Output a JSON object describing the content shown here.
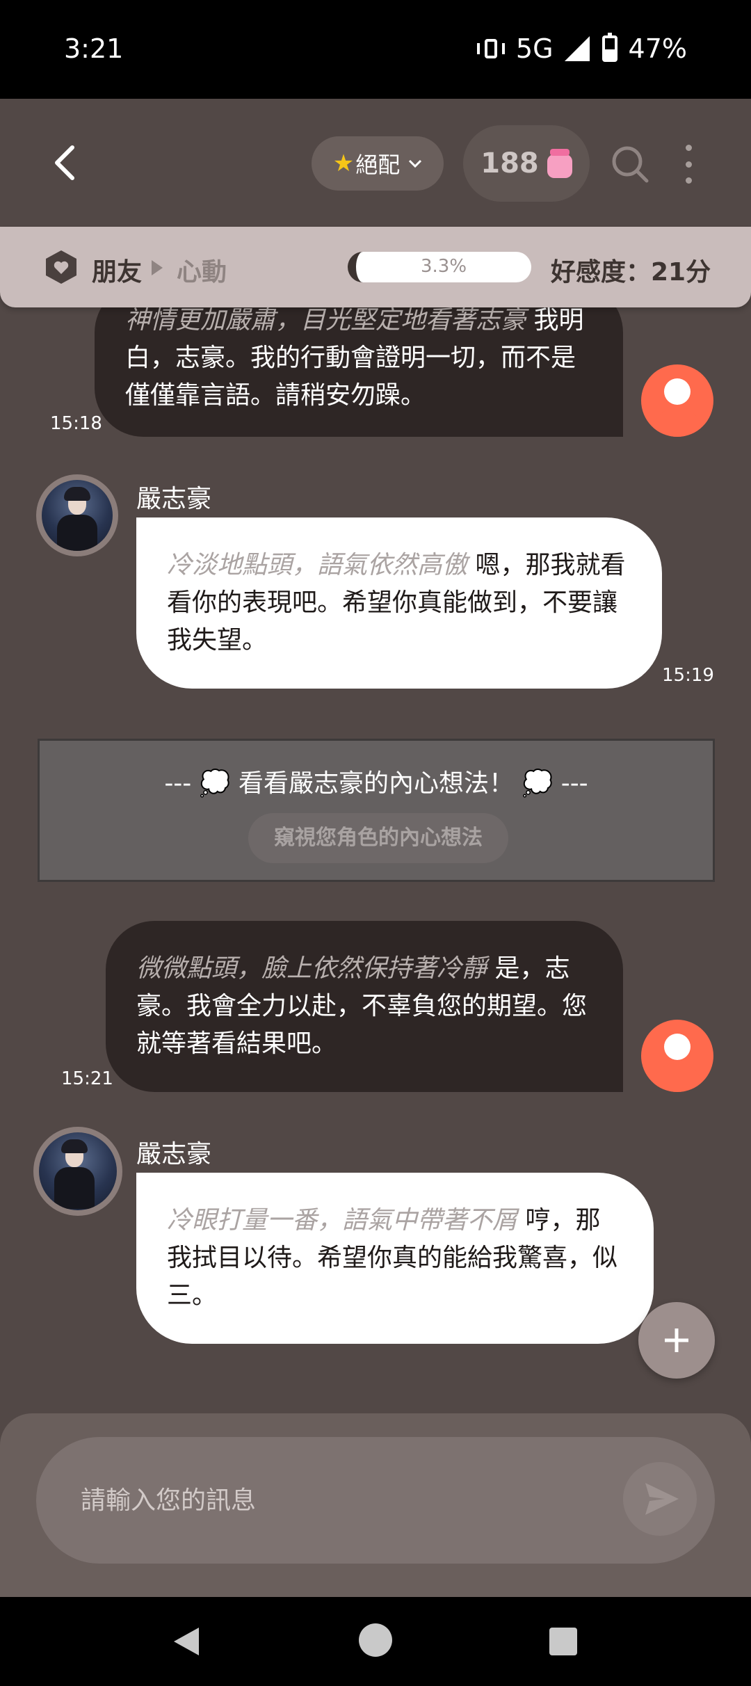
{
  "status": {
    "time": "3:21",
    "network": "5G",
    "battery": "47%"
  },
  "header": {
    "chip_label": "絕配",
    "coins": "188"
  },
  "relationship": {
    "level_current": "朋友",
    "level_next": "心動",
    "progress_text": "3.3%",
    "progress": 0.033,
    "score_text": "好感度：21分"
  },
  "chat": {
    "character_name": "嚴志豪",
    "messages": [
      {
        "from": "user",
        "action": "神情更加嚴肅，目光堅定地看著志豪",
        "line1": "我明",
        "line2": "白，志豪。我的行動會證明一切，而不是",
        "line3": "僅僅靠言語。請稍安勿躁。",
        "time": "15:18"
      },
      {
        "from": "character",
        "action": "冷淡地點頭，語氣依然高傲",
        "line1": "嗯，那我就看",
        "line2": "看你的表現吧。希望你真能做到，不要讓",
        "line3": "我失望。",
        "time": "15:19"
      },
      {
        "from": "user",
        "action": "微微點頭，臉上依然保持著冷靜",
        "line1": "是，志",
        "line2": "豪。我會全力以赴，不辜負您的期望。您",
        "line3": "就等著看結果吧。",
        "time": "15:21"
      },
      {
        "from": "character",
        "action": "冷眼打量一番，語氣中帶著不屑",
        "line1": "哼，那",
        "line2": "我拭目以待。希望你真的能給我驚喜，似",
        "line3": "三。",
        "time": ""
      }
    ]
  },
  "thought": {
    "title": "--- 💭 看看嚴志豪的內心想法！ 💭 ---",
    "button": "窺視您角色的內心想法"
  },
  "composer": {
    "placeholder": "請輸入您的訊息"
  },
  "colors": {
    "background": "#524846",
    "user_bubble": "#2e2625",
    "char_bubble": "#ffffff",
    "avatar_user": "#ff6a4d"
  }
}
